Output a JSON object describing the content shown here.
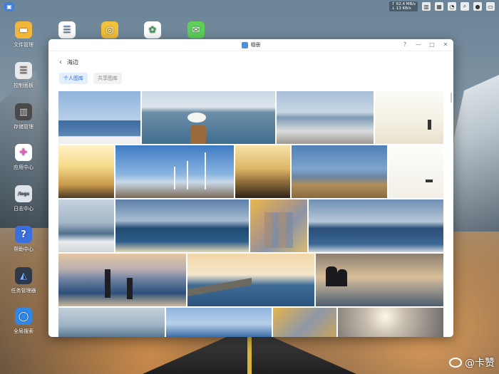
{
  "topbar": {
    "net_up": "↑ 62.4 MB/s",
    "net_down": "↓ 13 KB/s",
    "tray_icons": [
      "chart-icon",
      "grid-icon",
      "bell-icon",
      "search-icon",
      "user-icon",
      "layout-icon"
    ]
  },
  "desktop": {
    "icons": [
      {
        "label": "文件管理",
        "icon": "folder-icon"
      },
      {
        "label": "控制面板",
        "icon": "control-panel-icon"
      },
      {
        "label": "存储管理",
        "icon": "storage-icon"
      },
      {
        "label": "应用中心",
        "icon": "app-center-icon"
      },
      {
        "label": "日志中心",
        "icon": "log-icon",
        "glyph": "/logs"
      },
      {
        "label": "帮助中心",
        "icon": "help-icon",
        "glyph": "?"
      },
      {
        "label": "任务管理器",
        "icon": "task-manager-icon"
      },
      {
        "label": "全局搜索",
        "icon": "global-search-icon"
      }
    ]
  },
  "window": {
    "title": "相册",
    "album_name": "海边",
    "tabs": [
      {
        "label": "个人图库",
        "active": true
      },
      {
        "label": "共享图库",
        "active": false
      }
    ]
  },
  "watermark": "@卡赞",
  "photos": [
    {
      "scene": "calm sea horizon"
    },
    {
      "scene": "seagull on bollard"
    },
    {
      "scene": "pier over sea"
    },
    {
      "scene": "beach with people"
    },
    {
      "scene": "golden sea rocks"
    },
    {
      "scene": "wind turbines"
    },
    {
      "scene": "sunset water"
    },
    {
      "scene": "ship on sea"
    },
    {
      "scene": "seagulls flying"
    },
    {
      "scene": "ice shore"
    },
    {
      "scene": "seagulls island"
    },
    {
      "scene": "mosaic portrait"
    },
    {
      "scene": "birds over sea"
    },
    {
      "scene": "couple on beach"
    },
    {
      "scene": "breakwater with gulls"
    },
    {
      "scene": "silhouette couple"
    },
    {
      "scene": "sea horizon"
    },
    {
      "scene": "blue sea"
    },
    {
      "scene": "mosaic person"
    },
    {
      "scene": "sun haze"
    }
  ]
}
